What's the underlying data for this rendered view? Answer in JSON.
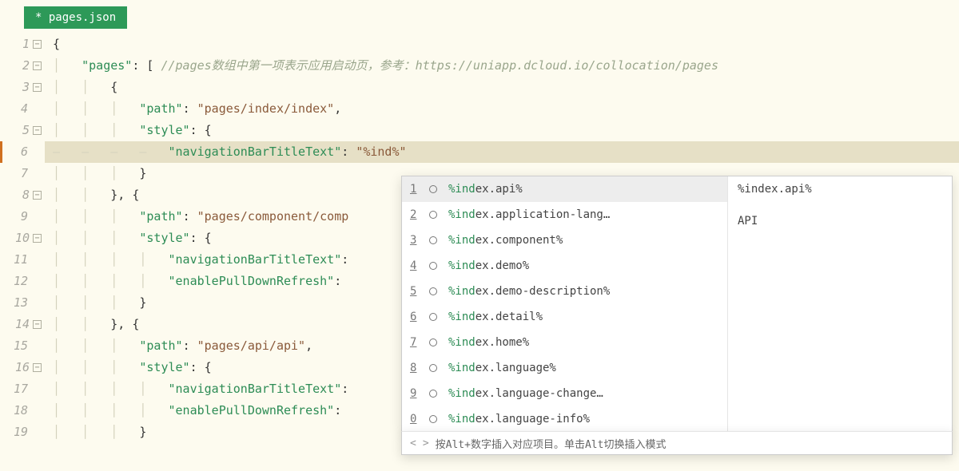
{
  "tab": {
    "label": "* pages.json"
  },
  "lines": [
    {
      "n": 1,
      "fold": true,
      "indent": 0,
      "segs": [
        {
          "cls": "p",
          "t": "{"
        }
      ]
    },
    {
      "n": 2,
      "fold": true,
      "indent": 1,
      "segs": [
        {
          "cls": "k",
          "t": "\"pages\""
        },
        {
          "cls": "p",
          "t": ": [ "
        },
        {
          "cls": "c",
          "t": "//pages数组中第一项表示应用启动页，参考：https://uniapp.dcloud.io/collocation/pages"
        }
      ]
    },
    {
      "n": 3,
      "fold": true,
      "indent": 2,
      "segs": [
        {
          "cls": "p",
          "t": "{"
        }
      ]
    },
    {
      "n": 4,
      "fold": false,
      "indent": 3,
      "segs": [
        {
          "cls": "k",
          "t": "\"path\""
        },
        {
          "cls": "p",
          "t": ": "
        },
        {
          "cls": "s",
          "t": "\"pages/index/index\""
        },
        {
          "cls": "p",
          "t": ","
        }
      ]
    },
    {
      "n": 5,
      "fold": true,
      "indent": 3,
      "segs": [
        {
          "cls": "k",
          "t": "\"style\""
        },
        {
          "cls": "p",
          "t": ": {"
        }
      ]
    },
    {
      "n": 6,
      "fold": false,
      "indent": 4,
      "hl": true,
      "segs": [
        {
          "cls": "k",
          "t": "\"navigationBarTitleText\""
        },
        {
          "cls": "p",
          "t": ": "
        },
        {
          "cls": "s",
          "t": "\"%ind%\""
        }
      ]
    },
    {
      "n": 7,
      "fold": false,
      "indent": 3,
      "segs": [
        {
          "cls": "p",
          "t": "}"
        }
      ]
    },
    {
      "n": 8,
      "fold": true,
      "indent": 2,
      "segs": [
        {
          "cls": "p",
          "t": "}, {"
        }
      ]
    },
    {
      "n": 9,
      "fold": false,
      "indent": 3,
      "segs": [
        {
          "cls": "k",
          "t": "\"path\""
        },
        {
          "cls": "p",
          "t": ": "
        },
        {
          "cls": "s",
          "t": "\"pages/component/comp"
        }
      ]
    },
    {
      "n": 10,
      "fold": true,
      "indent": 3,
      "segs": [
        {
          "cls": "k",
          "t": "\"style\""
        },
        {
          "cls": "p",
          "t": ": {"
        }
      ]
    },
    {
      "n": 11,
      "fold": false,
      "indent": 4,
      "segs": [
        {
          "cls": "k",
          "t": "\"navigationBarTitleText\""
        },
        {
          "cls": "p",
          "t": ":"
        }
      ]
    },
    {
      "n": 12,
      "fold": false,
      "indent": 4,
      "segs": [
        {
          "cls": "k",
          "t": "\"enablePullDownRefresh\""
        },
        {
          "cls": "p",
          "t": ":"
        }
      ]
    },
    {
      "n": 13,
      "fold": false,
      "indent": 3,
      "segs": [
        {
          "cls": "p",
          "t": "}"
        }
      ]
    },
    {
      "n": 14,
      "fold": true,
      "indent": 2,
      "segs": [
        {
          "cls": "p",
          "t": "}, {"
        }
      ]
    },
    {
      "n": 15,
      "fold": false,
      "indent": 3,
      "segs": [
        {
          "cls": "k",
          "t": "\"path\""
        },
        {
          "cls": "p",
          "t": ": "
        },
        {
          "cls": "s",
          "t": "\"pages/api/api\""
        },
        {
          "cls": "p",
          "t": ","
        }
      ]
    },
    {
      "n": 16,
      "fold": true,
      "indent": 3,
      "segs": [
        {
          "cls": "k",
          "t": "\"style\""
        },
        {
          "cls": "p",
          "t": ": {"
        }
      ]
    },
    {
      "n": 17,
      "fold": false,
      "indent": 4,
      "segs": [
        {
          "cls": "k",
          "t": "\"navigationBarTitleText\""
        },
        {
          "cls": "p",
          "t": ":"
        }
      ]
    },
    {
      "n": 18,
      "fold": false,
      "indent": 4,
      "segs": [
        {
          "cls": "k",
          "t": "\"enablePullDownRefresh\""
        },
        {
          "cls": "p",
          "t": ":"
        }
      ]
    },
    {
      "n": 19,
      "fold": false,
      "indent": 3,
      "segs": [
        {
          "cls": "p",
          "t": "}"
        }
      ]
    }
  ],
  "autocomplete": {
    "items": [
      {
        "num": "1",
        "match": "%ind",
        "rest": "ex.api%"
      },
      {
        "num": "2",
        "match": "%ind",
        "rest": "ex.application-lang…"
      },
      {
        "num": "3",
        "match": "%ind",
        "rest": "ex.component%"
      },
      {
        "num": "4",
        "match": "%ind",
        "rest": "ex.demo%"
      },
      {
        "num": "5",
        "match": "%ind",
        "rest": "ex.demo-description%"
      },
      {
        "num": "6",
        "match": "%ind",
        "rest": "ex.detail%"
      },
      {
        "num": "7",
        "match": "%ind",
        "rest": "ex.home%"
      },
      {
        "num": "8",
        "match": "%ind",
        "rest": "ex.language%"
      },
      {
        "num": "9",
        "match": "%ind",
        "rest": "ex.language-change…"
      },
      {
        "num": "0",
        "match": "%ind",
        "rest": "ex.language-info%"
      }
    ],
    "sideTitle": "%index.api%",
    "sideDesc": "API",
    "footer": "按Alt+数字插入对应项目。单击Alt切换插入模式"
  }
}
